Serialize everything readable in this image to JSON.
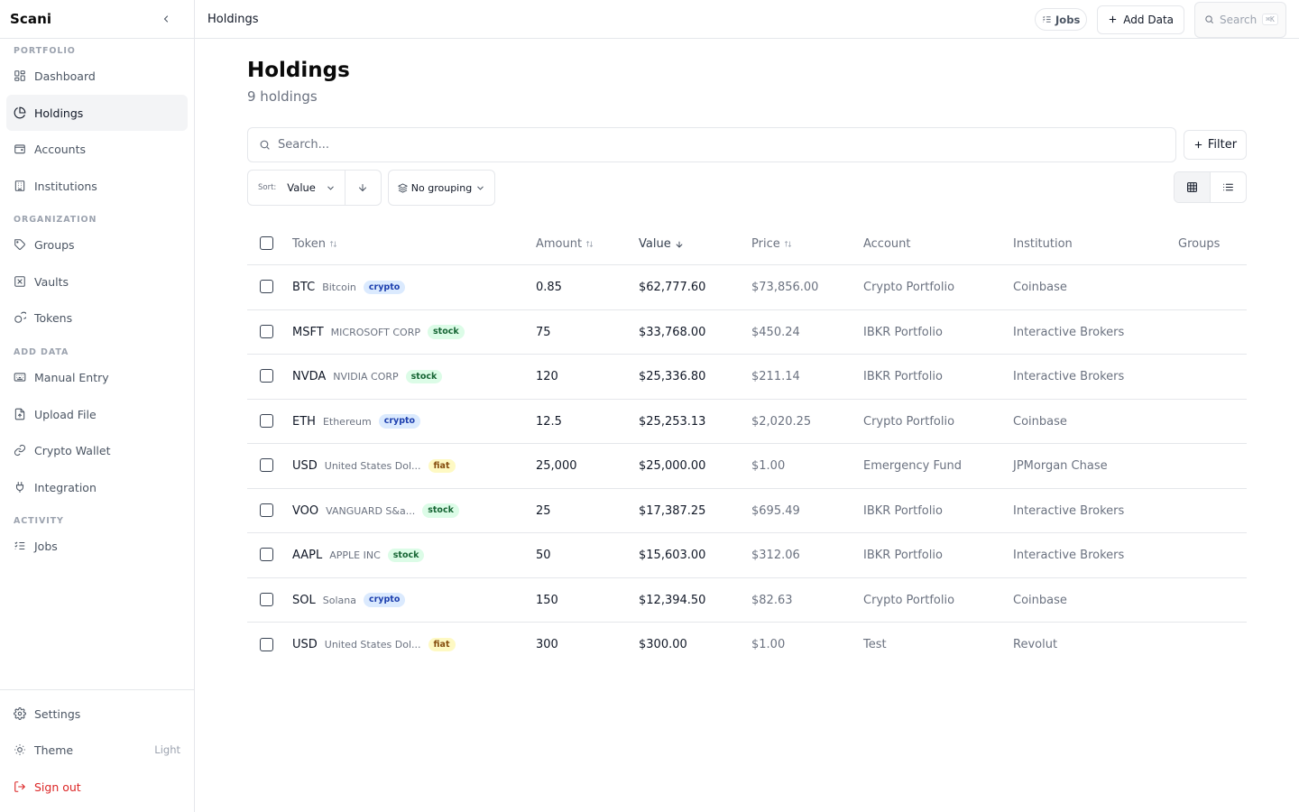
{
  "app": {
    "name": "Scani"
  },
  "sidebar": {
    "sections": [
      {
        "label": "PORTFOLIO"
      },
      {
        "label": "ORGANIZATION"
      },
      {
        "label": "ADD DATA"
      },
      {
        "label": "ACTIVITY"
      }
    ],
    "items": [
      {
        "label": "Dashboard",
        "icon": "dashboard-icon"
      },
      {
        "label": "Holdings",
        "icon": "pie-chart-icon",
        "active": true
      },
      {
        "label": "Accounts",
        "icon": "wallet-icon"
      },
      {
        "label": "Institutions",
        "icon": "building-icon"
      },
      {
        "label": "Groups",
        "icon": "tag-icon"
      },
      {
        "label": "Vaults",
        "icon": "vault-icon"
      },
      {
        "label": "Tokens",
        "icon": "coins-icon"
      },
      {
        "label": "Manual Entry",
        "icon": "keyboard-icon"
      },
      {
        "label": "Upload File",
        "icon": "file-upload-icon"
      },
      {
        "label": "Crypto Wallet",
        "icon": "link-icon"
      },
      {
        "label": "Integration",
        "icon": "plug-icon"
      },
      {
        "label": "Jobs",
        "icon": "list-checks-icon"
      }
    ],
    "footer": {
      "settings": "Settings",
      "theme": "Theme",
      "theme_value": "Light",
      "sign_out": "Sign out"
    }
  },
  "topbar": {
    "breadcrumb": "Holdings",
    "jobs": "Jobs",
    "add_data": "Add Data",
    "search": "Search",
    "search_shortcut": "⌘K"
  },
  "page": {
    "title": "Holdings",
    "subtitle": "9 holdings",
    "search_placeholder": "Search...",
    "filter": "Filter",
    "sort_label": "Sort:",
    "sort_value": "Value",
    "grouping": "No grouping"
  },
  "table": {
    "columns": [
      "Token",
      "Amount",
      "Value",
      "Price",
      "Account",
      "Institution",
      "Groups"
    ],
    "rows": [
      {
        "symbol": "BTC",
        "name": "Bitcoin",
        "type": "crypto",
        "amount": "0.85",
        "value": "$62,777.60",
        "price": "$73,856.00",
        "account": "Crypto Portfolio",
        "institution": "Coinbase",
        "groups": ""
      },
      {
        "symbol": "MSFT",
        "name": "MICROSOFT CORP",
        "type": "stock",
        "amount": "75",
        "value": "$33,768.00",
        "price": "$450.24",
        "account": "IBKR Portfolio",
        "institution": "Interactive Brokers",
        "groups": ""
      },
      {
        "symbol": "NVDA",
        "name": "NVIDIA CORP",
        "type": "stock",
        "amount": "120",
        "value": "$25,336.80",
        "price": "$211.14",
        "account": "IBKR Portfolio",
        "institution": "Interactive Brokers",
        "groups": ""
      },
      {
        "symbol": "ETH",
        "name": "Ethereum",
        "type": "crypto",
        "amount": "12.5",
        "value": "$25,253.13",
        "price": "$2,020.25",
        "account": "Crypto Portfolio",
        "institution": "Coinbase",
        "groups": ""
      },
      {
        "symbol": "USD",
        "name": "United States Dol...",
        "type": "fiat",
        "amount": "25,000",
        "value": "$25,000.00",
        "price": "$1.00",
        "account": "Emergency Fund",
        "institution": "JPMorgan Chase",
        "groups": ""
      },
      {
        "symbol": "VOO",
        "name": "VANGUARD S&a...",
        "type": "stock",
        "amount": "25",
        "value": "$17,387.25",
        "price": "$695.49",
        "account": "IBKR Portfolio",
        "institution": "Interactive Brokers",
        "groups": ""
      },
      {
        "symbol": "AAPL",
        "name": "APPLE INC",
        "type": "stock",
        "amount": "50",
        "value": "$15,603.00",
        "price": "$312.06",
        "account": "IBKR Portfolio",
        "institution": "Interactive Brokers",
        "groups": ""
      },
      {
        "symbol": "SOL",
        "name": "Solana",
        "type": "crypto",
        "amount": "150",
        "value": "$12,394.50",
        "price": "$82.63",
        "account": "Crypto Portfolio",
        "institution": "Coinbase",
        "groups": ""
      },
      {
        "symbol": "USD",
        "name": "United States Dol...",
        "type": "fiat",
        "amount": "300",
        "value": "$300.00",
        "price": "$1.00",
        "account": "Test",
        "institution": "Revolut",
        "groups": ""
      }
    ]
  },
  "colors": {
    "crypto_badge": "#dbeafe",
    "stock_badge": "#dcfce7",
    "fiat_badge": "#fef9c3",
    "danger": "#dc2626"
  }
}
